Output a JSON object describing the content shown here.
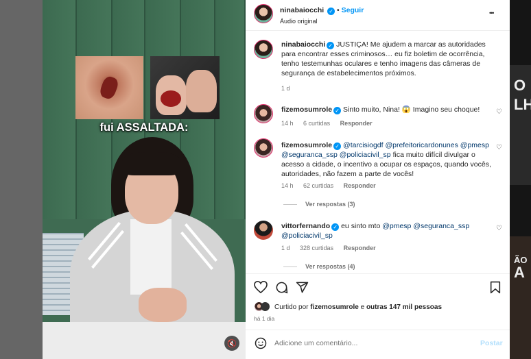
{
  "post": {
    "username": "ninabaiocchi",
    "follow_label": "Seguir",
    "audio": "Áudio original",
    "caption_overlay": "fui ASSALTADA:",
    "caption_text": "JUSTIÇA! Me ajudem a marcar as autoridades para encontrar esses criminosos… eu fiz boletim de ocorrência, tenho testemunhas oculares e tenho imagens das câmeras de segurança de estabelecimentos próximos.",
    "caption_time": "1 d",
    "more_glyph": "•••",
    "mute_glyph": "🔇"
  },
  "comments": [
    {
      "username": "fizemosumrole",
      "text": "Sinto muito, Nina! 😱 Imagino seu choque!",
      "time": "14 h",
      "likes": "6 curtidas",
      "reply": "Responder"
    },
    {
      "username": "fizemosumrole",
      "mentions_line1": "@tarcisiogdf @prefeitoricardonunes",
      "mentions_line2": "@pmesp @seguranca_ssp @policiacivil_sp",
      "text_after": " fica muito difícil",
      "text_rest": "divulgar o acesso a cidade, o incentivo a ocupar os espaços, quando vocês, autoridades, não fazem a parte de vocês!",
      "time": "14 h",
      "likes": "62 curtidas",
      "reply": "Responder",
      "view_replies": "Ver respostas (3)"
    },
    {
      "username": "vittorfernando",
      "text_start": "eu sinto mto ",
      "mention1": "@pmesp",
      "mention2": "@seguranca_ssp",
      "mention3": "@policiacivil_sp",
      "time": "1 d",
      "likes": "328 curtidas",
      "reply": "Responder",
      "view_replies": "Ver respostas (4)"
    }
  ],
  "actions": {
    "liked_by_prefix": "Curtido por ",
    "liked_by_user": "fizemosumrole",
    "liked_by_mid": " e ",
    "liked_by_others": "outras 147 mil pessoas",
    "post_time": "há 1 dia"
  },
  "add_comment": {
    "placeholder": "Adicione um comentário...",
    "post_label": "Postar"
  },
  "backdrop": {
    "right_text1": "O",
    "right_text2": "LH",
    "right_text3": "ÃO",
    "right_text4": "A"
  },
  "colors": {
    "accent": "#0095f6",
    "mention": "#00376b",
    "post_button": "#b2dffc"
  }
}
